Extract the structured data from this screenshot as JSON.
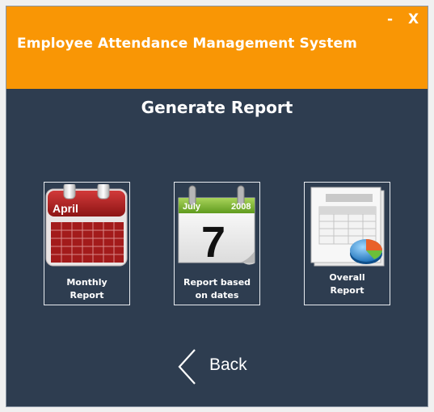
{
  "window": {
    "title": "Employee Attendance Management System",
    "minimize_label": "-",
    "close_label": "X"
  },
  "page": {
    "heading": "Generate Report"
  },
  "tiles": [
    {
      "label_lines": [
        "Monthly",
        "Report"
      ],
      "icon": "calendar-april-icon",
      "icon_text": "April"
    },
    {
      "label_lines": [
        "Report based",
        "on dates"
      ],
      "icon": "calendar-date-icon",
      "icon_text": {
        "month": "July",
        "year": "2008",
        "day": "7"
      }
    },
    {
      "label_lines": [
        "Overall",
        "Report"
      ],
      "icon": "report-chart-icon"
    }
  ],
  "back": {
    "label": "Back",
    "icon": "chevron-left-icon"
  },
  "colors": {
    "titlebar": "#f99605",
    "background": "#2e3d50",
    "text": "#ffffff"
  }
}
